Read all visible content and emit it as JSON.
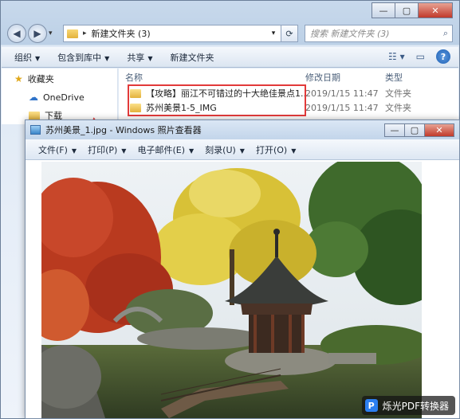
{
  "explorer": {
    "window_controls": {
      "minimize": "—",
      "maximize": "▢",
      "close": "✕"
    },
    "nav": {
      "back": "◀",
      "forward": "▶",
      "dropdown": "▾"
    },
    "address": {
      "separator": "▸",
      "path": "新建文件夹 (3)",
      "dropdown": "▾"
    },
    "refresh_icon": "⟳",
    "search_placeholder": "搜索 新建文件夹 (3)",
    "toolbar": {
      "organize": "组织",
      "include_in_library": "包含到库中",
      "share": "共享",
      "new_folder": "新建文件夹"
    },
    "navpane": {
      "favorites": "收藏夹",
      "onedrive": "OneDrive",
      "downloads": "下载"
    },
    "columns": {
      "name": "名称",
      "date": "修改日期",
      "type": "类型"
    },
    "files": [
      {
        "name": "【攻略】丽江不可错过的十大绝佳景点1...",
        "date": "2019/1/15 11:47",
        "type": "文件夹"
      },
      {
        "name": "苏州美景1-5_IMG",
        "date": "2019/1/15 11:47",
        "type": "文件夹"
      }
    ]
  },
  "viewer": {
    "title": "苏州美景_1.jpg - Windows 照片查看器",
    "menu": {
      "file": "文件(F)",
      "print": "打印(P)",
      "email": "电子邮件(E)",
      "burn": "刻录(U)",
      "open": "打开(O)"
    }
  },
  "watermark": {
    "logo": "P",
    "text": "烁光PDF转换器"
  },
  "colors": {
    "highlight": "#e23a3a",
    "accent": "#2c7ff0"
  }
}
